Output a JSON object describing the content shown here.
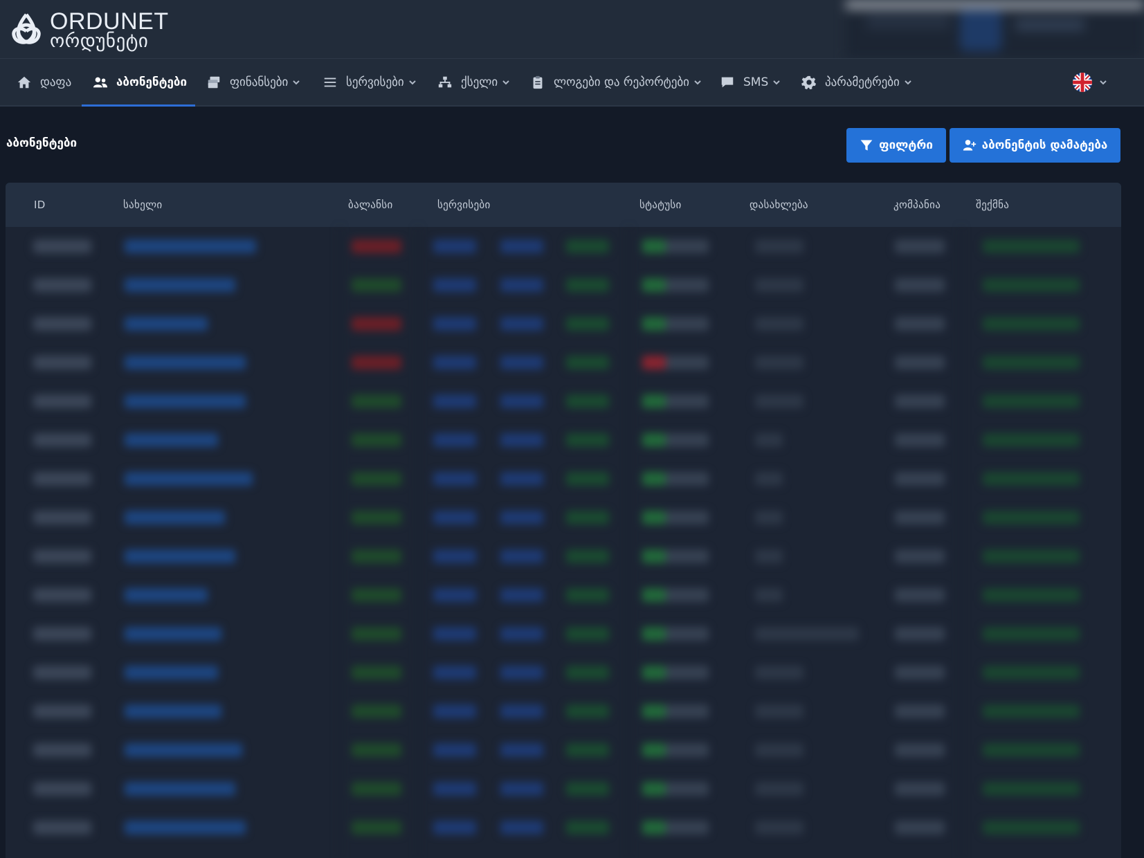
{
  "app": {
    "logo_line1": "ORDUNET",
    "logo_line2": "ორდუნეტი"
  },
  "nav": {
    "items": [
      {
        "label": "დაფა",
        "icon": "home-icon",
        "active": false
      },
      {
        "label": "აბონენტები",
        "icon": "users-icon",
        "active": true
      },
      {
        "label": "ფინანსები",
        "icon": "money-icon",
        "active": false
      },
      {
        "label": "სერვისები",
        "icon": "list-icon",
        "active": false
      },
      {
        "label": "ქსელი",
        "icon": "network-icon",
        "active": false
      },
      {
        "label": "ლოგები და რეპორტები",
        "icon": "clipboard-icon",
        "active": false
      },
      {
        "label": "SMS",
        "icon": "chat-icon",
        "active": false
      },
      {
        "label": "პარამეტრები",
        "icon": "gear-icon",
        "active": false
      }
    ],
    "language_flag": "uk-flag-icon"
  },
  "page": {
    "title": "აბონენტები",
    "filter_label": "ფილტრი",
    "add_label": "აბონენტის დამატება"
  },
  "table": {
    "columns": [
      "ID",
      "სახელი",
      "ბალანსი",
      "სერვისები",
      "სტატუსი",
      "დასახლება",
      "კომპანია",
      "შექმნა"
    ]
  },
  "colors": {
    "accent": "#2472d8",
    "background": "#131a27",
    "header": "#222c3a"
  }
}
